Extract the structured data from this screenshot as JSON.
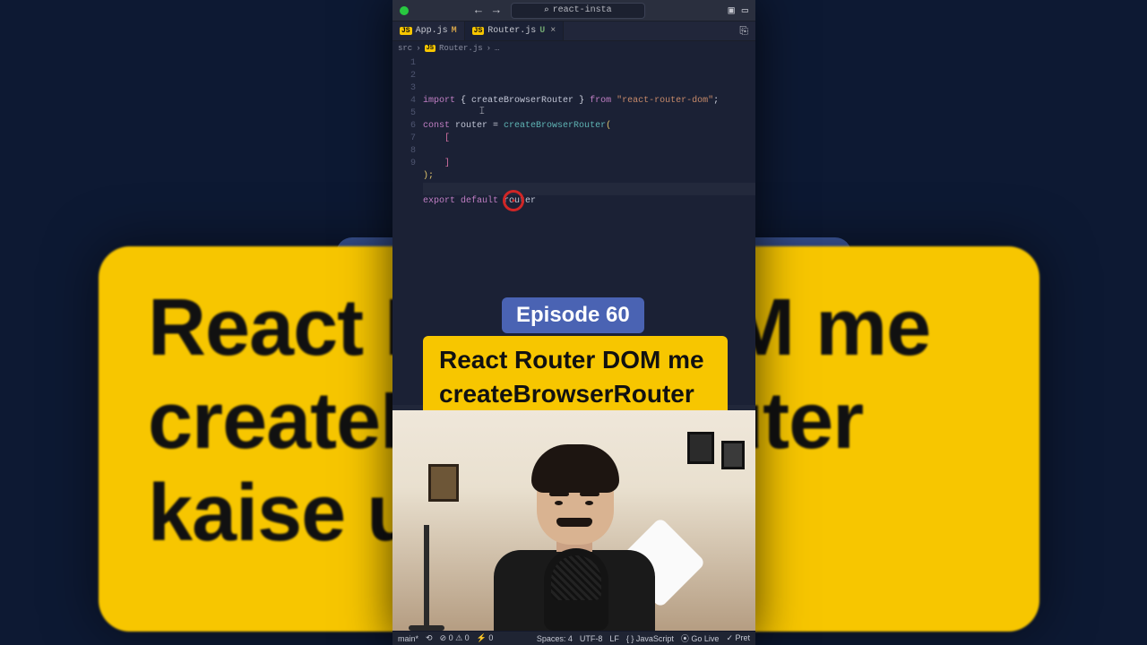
{
  "window": {
    "search_text": "react-insta"
  },
  "tabs": [
    {
      "icon": "JS",
      "label": "App.js",
      "flag": "M"
    },
    {
      "icon": "JS",
      "label": "Router.js",
      "flag": "U"
    }
  ],
  "breadcrumbs": {
    "folder": "src",
    "file": "Router.js",
    "more": "…"
  },
  "code": {
    "lines": [
      {
        "n": 1,
        "tokens": [
          {
            "t": "import ",
            "c": "tok-kw"
          },
          {
            "t": "{ ",
            "c": ""
          },
          {
            "t": "createBrowserRouter",
            "c": "tok-var"
          },
          {
            "t": " } ",
            "c": ""
          },
          {
            "t": "from ",
            "c": "tok-kw"
          },
          {
            "t": "\"react-router-dom\"",
            "c": "tok-str"
          },
          {
            "t": ";",
            "c": ""
          }
        ]
      },
      {
        "n": 2,
        "tokens": []
      },
      {
        "n": 3,
        "tokens": [
          {
            "t": "const ",
            "c": "tok-kw"
          },
          {
            "t": "router",
            "c": "tok-var"
          },
          {
            "t": " = ",
            "c": ""
          },
          {
            "t": "createBrowserRouter",
            "c": "tok-fn"
          },
          {
            "t": "(",
            "c": "tok-yellow"
          }
        ]
      },
      {
        "n": 4,
        "tokens": [
          {
            "t": "    [",
            "c": "tok-pink"
          }
        ]
      },
      {
        "n": 5,
        "tokens": [
          {
            "t": "        ",
            "c": ""
          }
        ]
      },
      {
        "n": 6,
        "tokens": [
          {
            "t": "    ]",
            "c": "tok-pink"
          }
        ]
      },
      {
        "n": 7,
        "tokens": [
          {
            "t": ");",
            "c": "tok-yellow"
          }
        ]
      },
      {
        "n": 8,
        "tokens": [],
        "hl": true
      },
      {
        "n": 9,
        "tokens": [
          {
            "t": "export default ",
            "c": "tok-kw"
          },
          {
            "t": "router",
            "c": "tok-var"
          }
        ]
      }
    ]
  },
  "overlay": {
    "episode": "Episode 60",
    "title": "React Router DOM me createBrowserRouter kaise use kre?"
  },
  "bg_text": "React R\ncreateB\nkaise u",
  "bg_text_right": "OM me\nouter",
  "status": {
    "branch": "main*",
    "sync": "⟲",
    "problems": "⊘ 0 ⚠ 0",
    "port": "⚡ 0",
    "spaces": "Spaces: 4",
    "encoding": "UTF-8",
    "eol": "LF",
    "lang": "{ } JavaScript",
    "golive": "⦿ Go Live",
    "pret": "✓ Pret"
  }
}
